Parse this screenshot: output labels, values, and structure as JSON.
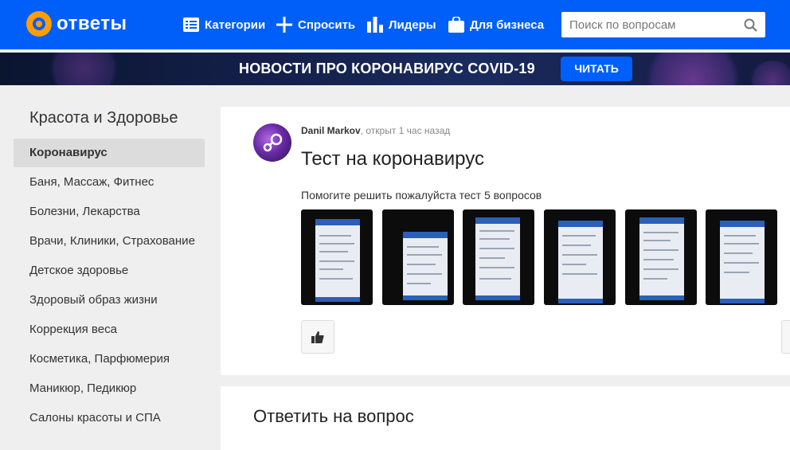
{
  "header": {
    "logo_text": "ответы",
    "nav": [
      {
        "label": "Категории",
        "icon": "list-icon"
      },
      {
        "label": "Спросить",
        "icon": "plus-icon"
      },
      {
        "label": "Лидеры",
        "icon": "bar-chart-icon"
      },
      {
        "label": "Для бизнеса",
        "icon": "bag-icon"
      }
    ],
    "search_placeholder": "Поиск по вопросам"
  },
  "banner": {
    "text": "НОВОСТИ ПРО КОРОНАВИРУС COVID-19",
    "button_label": "ЧИТАТЬ"
  },
  "sidebar": {
    "title": "Красота и Здоровье",
    "items": [
      {
        "label": "Коронавирус",
        "active": true
      },
      {
        "label": "Баня, Массаж, Фитнес"
      },
      {
        "label": "Болезни, Лекарства"
      },
      {
        "label": "Врачи, Клиники, Страхование"
      },
      {
        "label": "Детское здоровье"
      },
      {
        "label": "Здоровый образ жизни"
      },
      {
        "label": "Коррекция веса"
      },
      {
        "label": "Косметика, Парфюмерия"
      },
      {
        "label": "Маникюр, Педикюр"
      },
      {
        "label": "Салоны красоты и СПА"
      }
    ]
  },
  "question": {
    "author": "Danil Markov",
    "meta": ", открыт 1 час назад",
    "title": "Тест на коронавирус",
    "text": "Помогите решить пожалуйста тест 5 вопросов",
    "images_count": 6
  },
  "answer_section": {
    "title": "Ответить на вопрос"
  },
  "colors": {
    "brand_blue": "#005ff9",
    "logo_orange": "#ff9e00"
  }
}
